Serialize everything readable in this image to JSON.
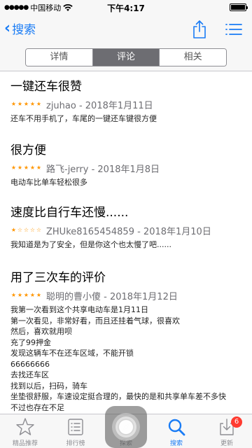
{
  "status_bar": {
    "carrier": "中国移动",
    "time": "下午4:17"
  },
  "nav": {
    "back_label": "搜索",
    "accent_color": "#1a7cf5"
  },
  "segments": [
    {
      "label": "详情",
      "active": false
    },
    {
      "label": "评论",
      "active": true
    },
    {
      "label": "相关",
      "active": false
    }
  ],
  "reviews": [
    {
      "title": "一键还车很赞",
      "rating": 5,
      "author_date": "zjuhao - 2018年1月11日",
      "body": "还车不用手机了，车尾的一键还车键很方便"
    },
    {
      "title": "很方便",
      "rating": 5,
      "author_date": "路飞-jerry - 2018年1月8日",
      "body": "电动车比单车轻松很多"
    },
    {
      "title": "速度比自行车还慢......",
      "rating": 1,
      "author_date": "ZHUke8165454859 - 2018年1月10日",
      "body": "我知道是为了安全，但是你这个也太慢了吧......"
    },
    {
      "title": "用了三次车的评价",
      "rating": 5,
      "author_date": "聪明的曹小傻 - 2018年1月12日",
      "body": "我第一次看到这个共享电动车是1月11日\n第一次看见，非常好看，而且还挂着气球，很喜欢\n然后，喜欢就用呗\n充了99押金\n发现这辆车不在还车区域，不能开锁\n66666666\n去找还车区\n找到以后，扫码，骑车\n坐垫很舒服，车速设定挺合理的，最快的是和共享单车差不多快\n不过也存在不足\n但是，总体体验很棒"
    }
  ],
  "tab_bar": {
    "items": [
      {
        "label": "精品推荐",
        "icon": "star-icon",
        "active": false
      },
      {
        "label": "排行榜",
        "icon": "list-icon",
        "active": false
      },
      {
        "label": "探索",
        "icon": "compass-icon",
        "active": false
      },
      {
        "label": "搜索",
        "icon": "search-icon",
        "active": true
      },
      {
        "label": "更新",
        "icon": "download-icon",
        "active": false,
        "badge": "6"
      }
    ]
  }
}
